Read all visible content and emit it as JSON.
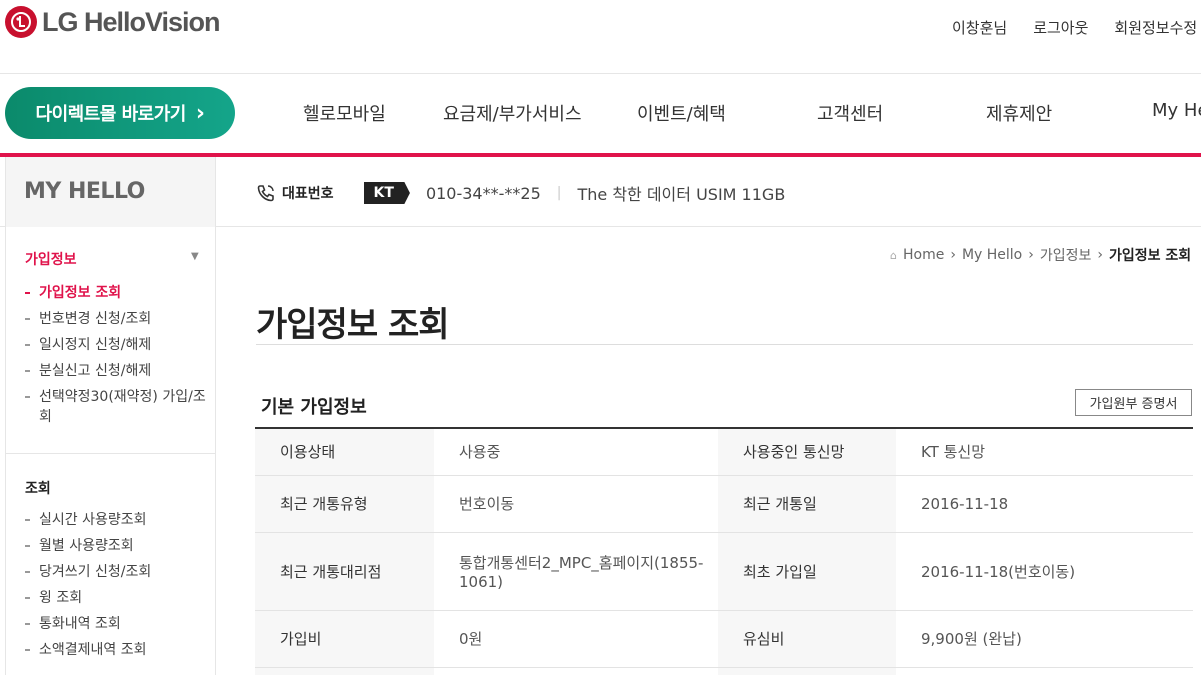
{
  "header": {
    "logo_text": "LG HelloVision",
    "user_name": "이창훈님",
    "logout": "로그아웃",
    "edit_profile": "회원정보수정"
  },
  "nav": {
    "direct_button": "다이렉트몰 바로가기",
    "direct_button_chevron": "›",
    "items": [
      "헬로모바일",
      "요금제/부가서비스",
      "이벤트/혜택",
      "고객센터",
      "제휴제안",
      "My He"
    ]
  },
  "subheader": {
    "section_title": "MY HELLO",
    "rep_label": "대표번호",
    "carrier": "KT",
    "phone_number": "010-34**-**25",
    "separator": "|",
    "plan_name": "The 착한 데이터 USIM 11GB"
  },
  "sidebar": {
    "section1_title": "가입정보",
    "section1_items": [
      "가입정보 조회",
      "번호변경 신청/조회",
      "일시정지 신청/해제",
      "분실신고 신청/해제",
      "선택약정30(재약정) 가입/조회"
    ],
    "section2_title": "조회",
    "section2_items": [
      "실시간 사용량조회",
      "월별 사용량조회",
      "당겨쓰기 신청/조회",
      "윙 조회",
      "통화내역 조회",
      "소액결제내역 조회"
    ]
  },
  "breadcrumb": [
    "Home",
    "My Hello",
    "가입정보",
    "가입정보 조회"
  ],
  "main": {
    "page_title": "가입정보 조회",
    "section_title": "기본 가입정보",
    "cert_button": "가입원부 증명서",
    "rows": [
      {
        "label1": "이용상태",
        "value1": "사용중",
        "label2": "사용중인 통신망",
        "value2": "KT 통신망"
      },
      {
        "label1": "최근 개통유형",
        "value1": "번호이동",
        "label2": "최근 개통일",
        "value2": "2016-11-18"
      },
      {
        "label1": "최근 개통대리점",
        "value1": "통합개통센터2_MPC_홈페이지(1855-1061)",
        "label2": "최초 가입일",
        "value2": "2016-11-18(번호이동)"
      },
      {
        "label1": "가입비",
        "value1": "0원",
        "label2": "유심비",
        "value2": "9,900원 (완납)"
      }
    ]
  }
}
